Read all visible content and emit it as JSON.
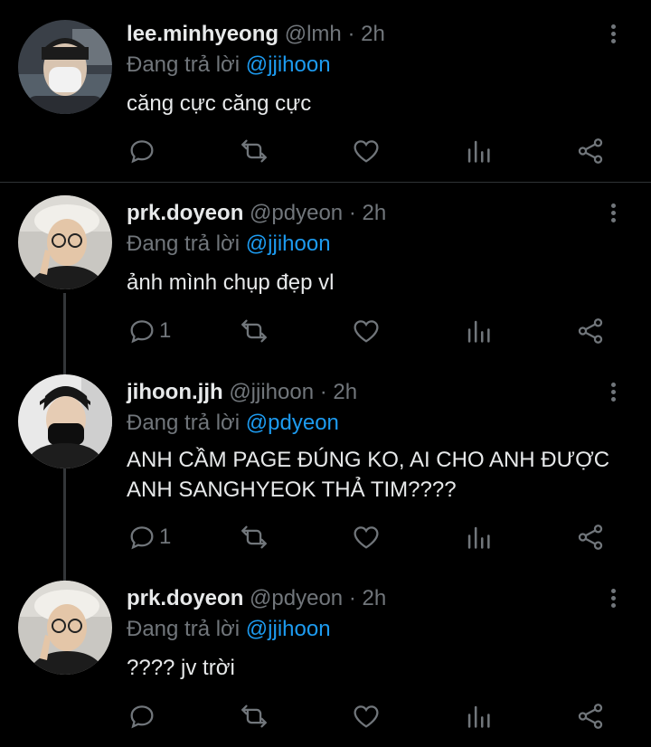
{
  "reply_prefix": "Đang trả lời",
  "colors": {
    "background": "#000000",
    "text": "#e7e9ea",
    "muted": "#71767b",
    "link": "#1d9bf0"
  },
  "tweets": [
    {
      "name": "lee.minhyeong",
      "handle": "@lmh",
      "dot": "·",
      "time": "2h",
      "reply_to": "@jjihoon",
      "text": "căng cực căng cực",
      "reply_count": "",
      "avatar_desc": "person-wearing-white-mask"
    },
    {
      "name": "prk.doyeon",
      "handle": "@pdyeon",
      "dot": "·",
      "time": "2h",
      "reply_to": "@jjihoon",
      "text": "ảnh mình chụp đẹp vl",
      "reply_count": "1",
      "avatar_desc": "person-with-white-beret-and-glasses"
    },
    {
      "name": "jihoon.jjh",
      "handle": "@jjihoon",
      "dot": "·",
      "time": "2h",
      "reply_to": "@pdyeon",
      "text_lines": [
        "ANH CẦM PAGE ĐÚNG KO, AI CHO ANH ĐƯỢC",
        "ANH SANGHYEOK THẢ TIM????"
      ],
      "reply_count": "1",
      "avatar_desc": "person-wearing-black-mask"
    },
    {
      "name": "prk.doyeon",
      "handle": "@pdyeon",
      "dot": "·",
      "time": "2h",
      "reply_to": "@jjihoon",
      "text": "???? jv trời",
      "reply_count": "",
      "avatar_desc": "person-with-white-beret-and-glasses"
    }
  ]
}
